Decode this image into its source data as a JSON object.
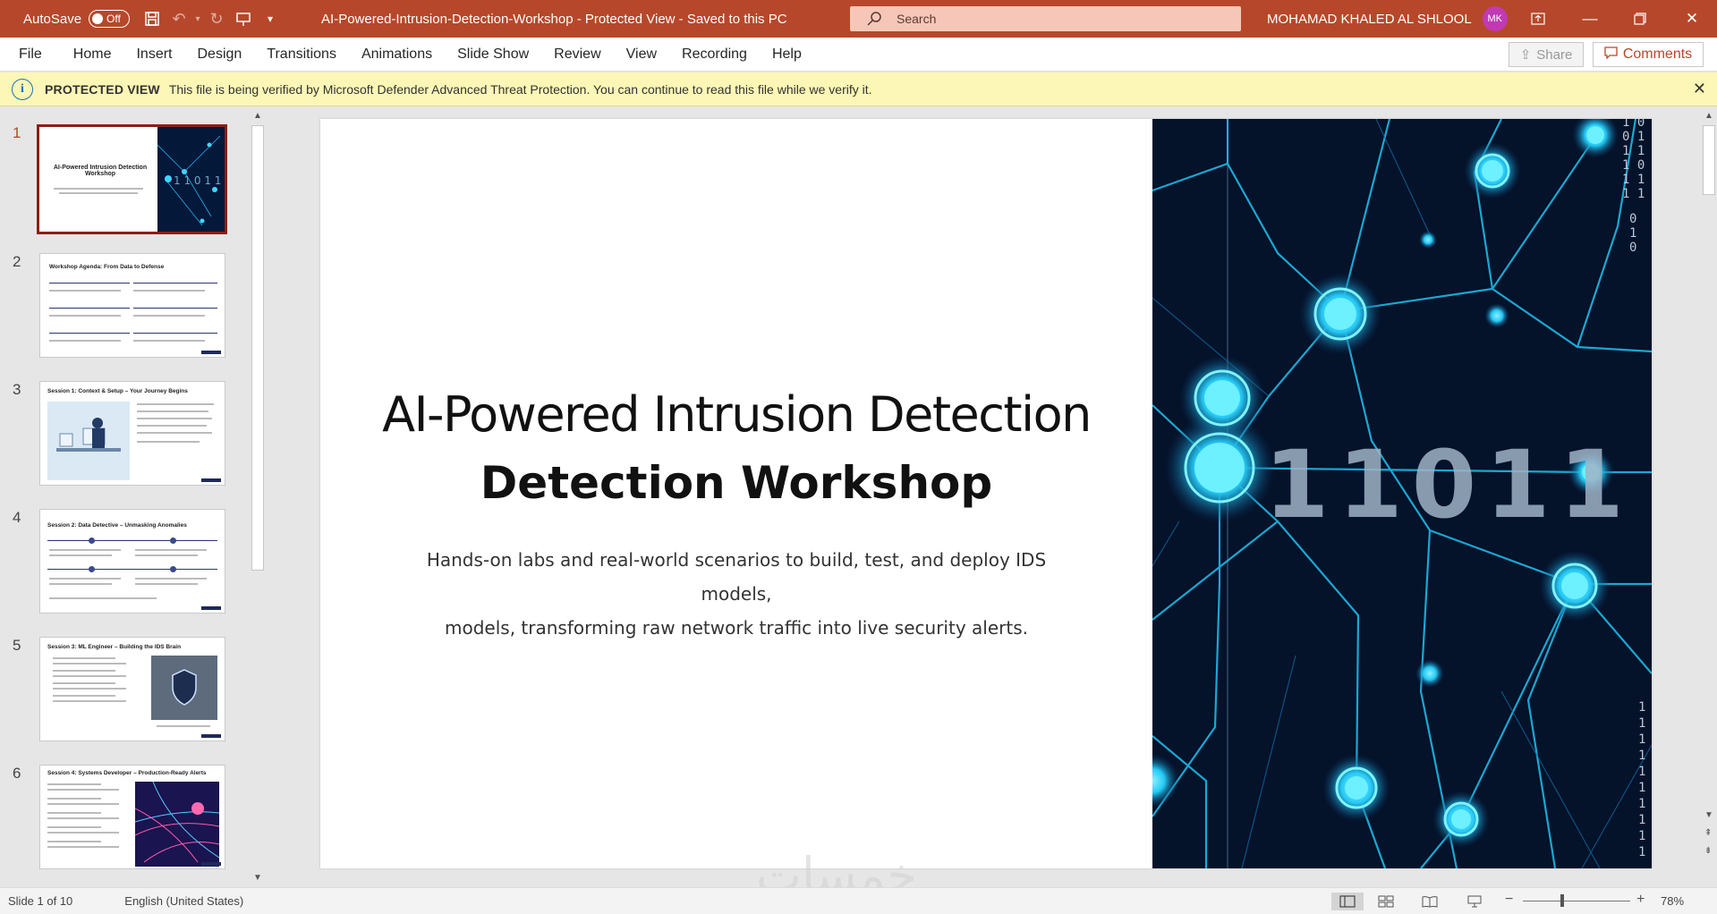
{
  "titlebar": {
    "autosave_label": "AutoSave",
    "autosave_state": "Off",
    "doc_title": "AI-Powered-Intrusion-Detection-Workshop  -  Protected View  -  Saved to this PC",
    "search_placeholder": "Search",
    "user_name": "MOHAMAD KHALED AL SHLOOL",
    "user_initials": "MK"
  },
  "ribbon": {
    "tabs": [
      "File",
      "Home",
      "Insert",
      "Design",
      "Transitions",
      "Animations",
      "Slide Show",
      "Review",
      "View",
      "Recording",
      "Help"
    ],
    "share_label": "Share",
    "comments_label": "Comments"
  },
  "banner": {
    "label": "PROTECTED VIEW",
    "message": "This file is being verified by Microsoft Defender Advanced Threat Protection. You can continue to read this file while we verify it."
  },
  "thumbnails": [
    {
      "number": "1",
      "title": "AI-Powered Intrusion Detection Workshop"
    },
    {
      "number": "2",
      "title": "Workshop Agenda: From Data to Defense"
    },
    {
      "number": "3",
      "title": "Session 1: Context & Setup – Your Journey Begins"
    },
    {
      "number": "4",
      "title": "Session 2: Data Detective – Unmasking Anomalies"
    },
    {
      "number": "5",
      "title": "Session 3: ML Engineer – Building the IDS Brain"
    },
    {
      "number": "6",
      "title": "Session 4: Systems Developer – Production-Ready Alerts"
    }
  ],
  "slide": {
    "title_line1": "AI-Powered Intrusion Detection",
    "title_line2": "Detection Workshop",
    "subtitle_line1": "Hands-on labs and real-world scenarios to build, test, and deploy IDS models,",
    "subtitle_line2": "models, transforming raw network traffic into live security alerts.",
    "binary_text": "11011",
    "watermark": "خمسات"
  },
  "status": {
    "slide_count": "Slide 1 of 10",
    "language": "English (United States)",
    "zoom": "78%"
  }
}
